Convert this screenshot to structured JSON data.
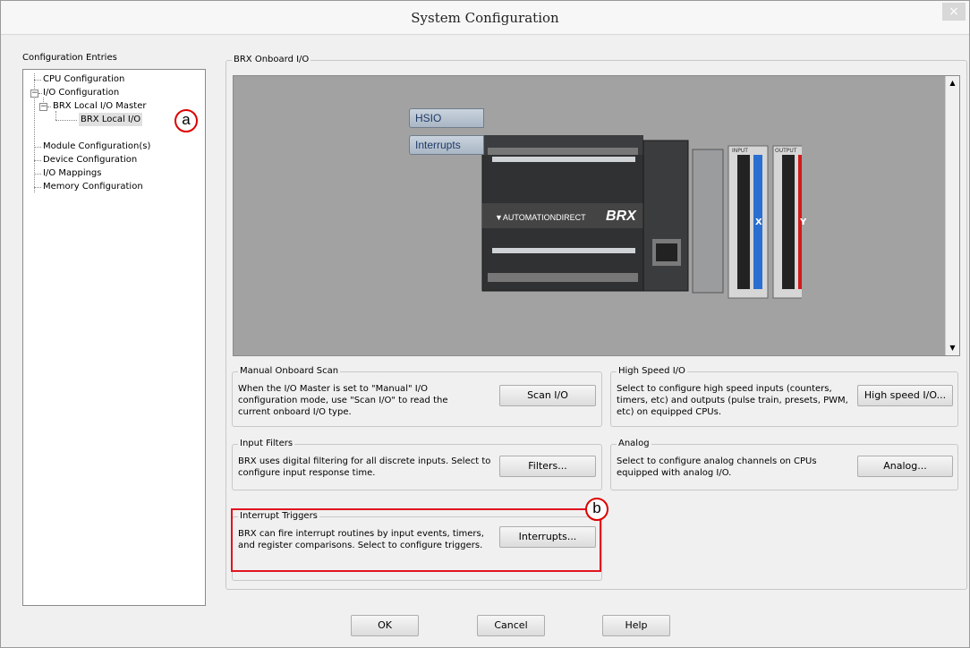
{
  "window": {
    "title": "System Configuration",
    "close_label": "×"
  },
  "tree": {
    "heading": "Configuration Entries",
    "items": [
      {
        "label": "CPU Configuration"
      },
      {
        "label": "I/O Configuration",
        "toggle": "−"
      },
      {
        "label": "BRX Local I/O Master",
        "toggle": "−"
      },
      {
        "label": "BRX Local I/O"
      },
      {
        "label": "Module Configuration(s)"
      },
      {
        "label": "Device Configuration"
      },
      {
        "label": "I/O Mappings"
      },
      {
        "label": "Memory Configuration"
      }
    ]
  },
  "main": {
    "group_title": "BRX Onboard I/O",
    "viewer": {
      "hsio_label": "HSIO",
      "interrupts_label": "Interrupts",
      "brand": "▼AUTOMATIONDIRECT",
      "model": "BRX",
      "input_label": "INPUT",
      "output_label": "OUTPUT",
      "input_letter": "X",
      "output_letter": "Y",
      "scroll_up": "▲",
      "scroll_down": "▼"
    },
    "sections": {
      "manual_scan": {
        "title": "Manual Onboard Scan",
        "text": "When the I/O Master is set to \"Manual\" I/O configuration mode, use \"Scan I/O\" to read the current onboard I/O type.",
        "button": "Scan I/O"
      },
      "high_speed": {
        "title": "High Speed I/O",
        "text": "Select to configure high speed inputs (counters, timers, etc) and outputs (pulse train, presets, PWM, etc) on equipped CPUs.",
        "button": "High speed I/O..."
      },
      "input_filters": {
        "title": "Input Filters",
        "text": "BRX uses digital filtering for all discrete inputs. Select to configure input response time.",
        "button": "Filters..."
      },
      "analog": {
        "title": "Analog",
        "text": "Select to configure analog channels on CPUs equipped with analog I/O.",
        "button": "Analog..."
      },
      "interrupt_triggers": {
        "title": "Interrupt Triggers",
        "text": "BRX can fire interrupt routines by input events, timers, and register comparisons. Select to configure triggers.",
        "button": "Interrupts..."
      }
    }
  },
  "annotations": {
    "a": "a",
    "b": "b",
    "accent": "#e0141e"
  },
  "footer": {
    "ok": "OK",
    "cancel": "Cancel",
    "help": "Help"
  }
}
